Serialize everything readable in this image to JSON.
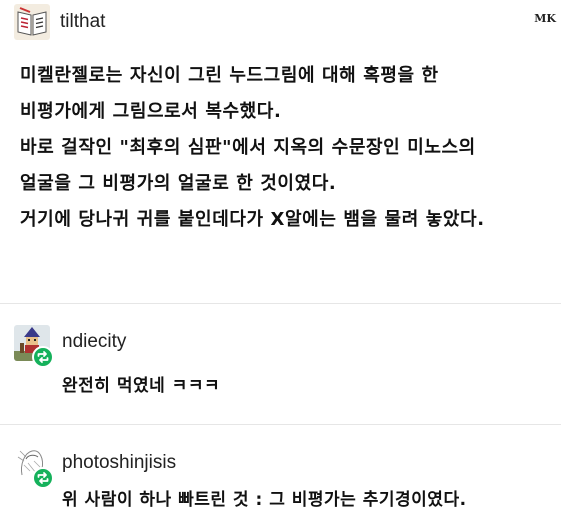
{
  "post": {
    "username": "tilthat",
    "avatar_icon": "book-avatar-icon",
    "watermark": "MK",
    "lines": [
      "미켈란젤로는 자신이 그린 누드그림에 대해 혹평을 한",
      "비평가에게 그림으로서 복수했다.",
      "바로 걸작인 \"최후의 심판\"에서 지옥의 수문장인 미노스의",
      "얼굴을 그 비평가의 얼굴로 한 것이였다.",
      "거기에 당나귀 귀를 붙인데다가 X알에는 뱀을 물려 놓았다."
    ]
  },
  "reblogs": [
    {
      "username": "ndiecity",
      "avatar_icon": "pixel-character-avatar-icon",
      "badge_icon": "reblog-icon",
      "comment": "완전히 먹였네 ㅋㅋㅋ"
    },
    {
      "username": "photoshinjisis",
      "avatar_icon": "sketch-avatar-icon",
      "badge_icon": "reblog-icon",
      "comment": "위 사람이 하나 빠트린 것 : 그 비평가는 추기경이였다."
    }
  ],
  "colors": {
    "reblog_green": "#15b15b",
    "divider": "#e6e6e6"
  }
}
